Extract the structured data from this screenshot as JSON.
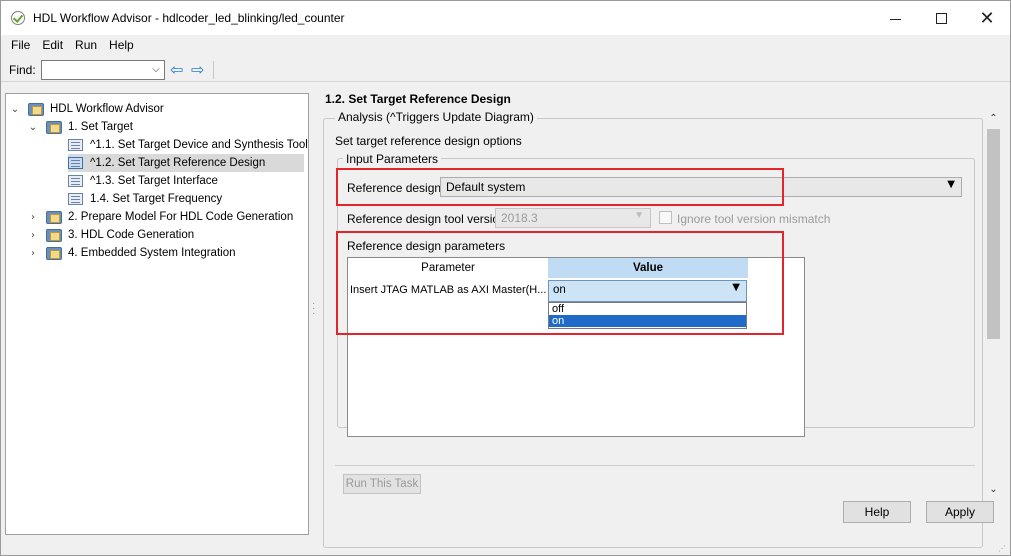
{
  "window": {
    "title": "HDL Workflow Advisor - hdlcoder_led_blinking/led_counter",
    "app_icon": "check-circle-icon"
  },
  "menu": [
    "File",
    "Edit",
    "Run",
    "Help"
  ],
  "find": {
    "label": "Find:",
    "value": ""
  },
  "tree": {
    "root": "HDL Workflow Advisor",
    "items": [
      {
        "label": "1. Set Target",
        "expanded": true
      },
      {
        "label": "^1.1. Set Target Device and Synthesis Tool"
      },
      {
        "label": "^1.2. Set Target Reference Design",
        "selected": true
      },
      {
        "label": "^1.3. Set Target Interface"
      },
      {
        "label": "1.4. Set Target Frequency"
      },
      {
        "label": "2. Prepare Model For HDL Code Generation"
      },
      {
        "label": "3. HDL Code Generation"
      },
      {
        "label": "4. Embedded System Integration"
      }
    ]
  },
  "content": {
    "section_title": "1.2. Set Target Reference Design",
    "analysis_label": "Analysis (^Triggers Update Diagram)",
    "set_options": "Set target reference design options",
    "input_params_label": "Input Parameters",
    "reference_design_label": "Reference design:",
    "reference_design_value": "Default system",
    "tool_version_label": "Reference design tool version:",
    "tool_version_value": "2018.3",
    "ignore_mismatch_label": "Ignore tool version mismatch",
    "rdp_label": "Reference design parameters",
    "table": {
      "header_parameter": "Parameter",
      "header_value": "Value",
      "row_param": "Insert JTAG MATLAB as AXI Master(H...",
      "row_value": "on",
      "options": [
        "off",
        "on"
      ]
    },
    "run_task": "Run This Task",
    "help": "Help",
    "apply": "Apply"
  },
  "colors": {
    "highlight": "#e0262b",
    "selected_option": "#1f6bc7",
    "value_header": "#bfdcf4"
  }
}
